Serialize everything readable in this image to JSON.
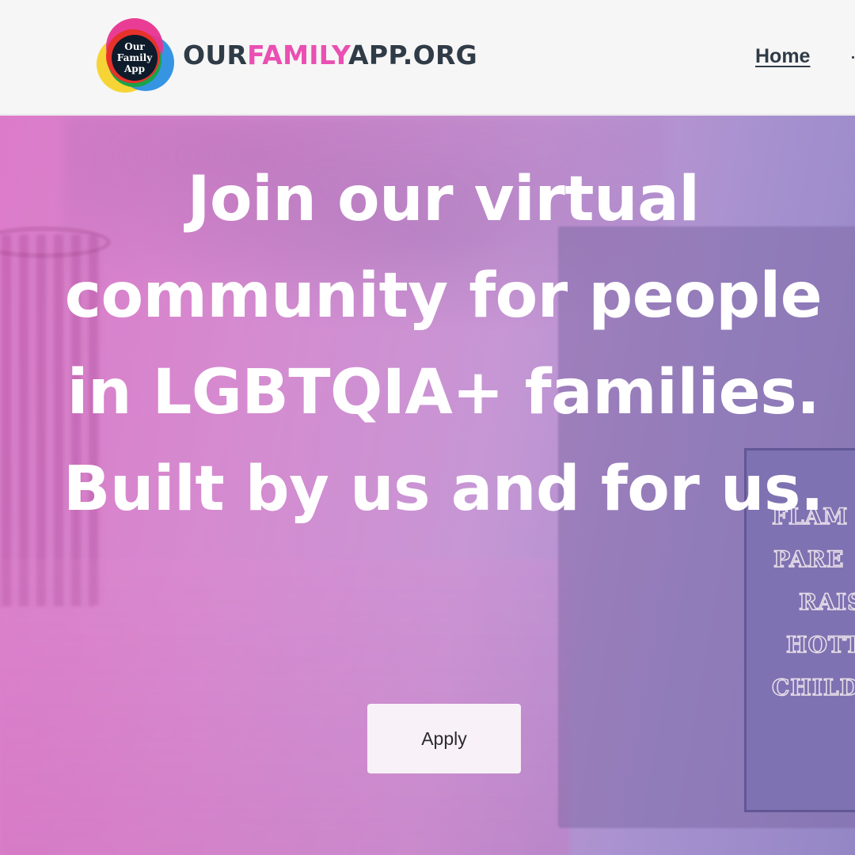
{
  "header": {
    "logo": {
      "line1": "Our",
      "line2": "Family",
      "line3": "App",
      "ring_colors": [
        "#e8338f",
        "#e7322b",
        "#f6d22a",
        "#1aa34a",
        "#2b8fe0"
      ]
    },
    "brand": {
      "part1": "OUR",
      "part2": "FAMILY",
      "part3": "APP.ORG"
    },
    "nav": {
      "home_label": "Home"
    }
  },
  "hero": {
    "headline": "Join our virtual community for people in LGBTQIA+ families. Built by us and for us.",
    "apply_label": "Apply",
    "sign_lines": [
      "FLAM",
      "PARE",
      "RAIS",
      "HOTT",
      "CHILD"
    ]
  },
  "colors": {
    "brand_dark": "#2f3b46",
    "brand_pink": "#ea4fb2",
    "header_bg": "#f6f6f6",
    "hero_overlay_start": "#dc7bc9",
    "hero_overlay_end": "#9486c5"
  }
}
